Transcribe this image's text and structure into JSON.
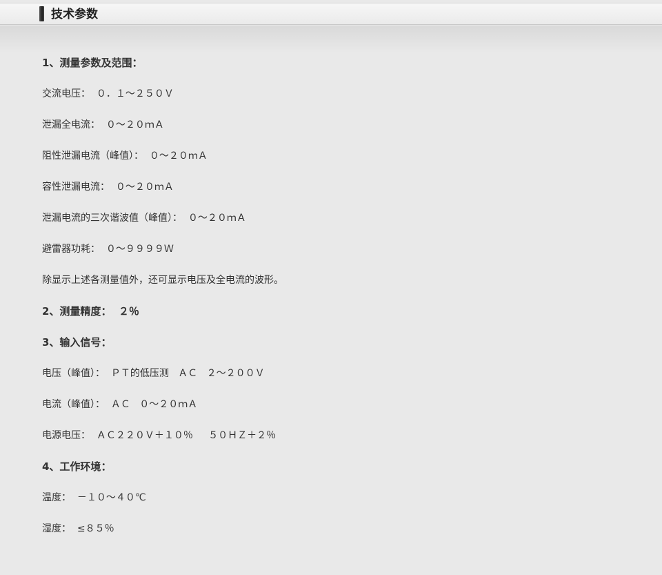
{
  "header": {
    "title": "技术参数"
  },
  "content": {
    "lines": [
      {
        "text": "1、测量参数及范围：",
        "bold": true
      },
      {
        "text": "交流电压：  ０．１～２５０Ｖ",
        "bold": false
      },
      {
        "text": "泄漏全电流：  ０～２０ｍＡ",
        "bold": false
      },
      {
        "text": "阻性泄漏电流（峰值）：  ０～２０ｍＡ",
        "bold": false
      },
      {
        "text": "容性泄漏电流：  ０～２０ｍＡ",
        "bold": false
      },
      {
        "text": "泄漏电流的三次谐波值（峰值）：  ０～２０ｍＡ",
        "bold": false
      },
      {
        "text": "避雷器功耗：  ０～９９９９Ｗ",
        "bold": false
      },
      {
        "text": "除显示上述各测量值外，还可显示电压及全电流的波形。",
        "bold": false
      },
      {
        "text": "2、测量精度：  ２％",
        "bold": true
      },
      {
        "text": "3、输入信号：",
        "bold": true
      },
      {
        "text": "电压（峰值）：  ＰＴ的低压测   ＡＣ   ２～２００Ｖ",
        "bold": false
      },
      {
        "text": "电流（峰值）：  ＡＣ   ０～２０ｍＡ",
        "bold": false
      },
      {
        "text": "电源电压：  ＡＣ２２０Ｖ＋１０％     ５０ＨＺ＋２％",
        "bold": false
      },
      {
        "text": "4、工作环境：",
        "bold": true
      },
      {
        "text": "温度：  －１０～４０℃",
        "bold": false
      },
      {
        "text": "湿度：  ≤８５％",
        "bold": false
      }
    ]
  }
}
